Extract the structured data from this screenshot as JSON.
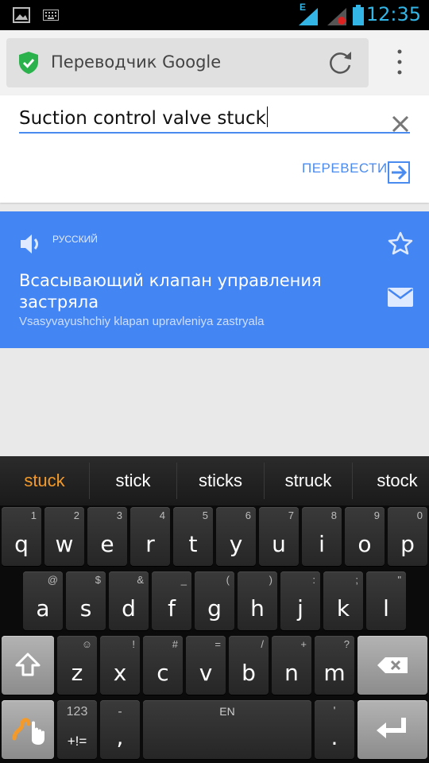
{
  "status_bar": {
    "time": "12:35",
    "network_type": "E"
  },
  "browser": {
    "tab_title": "Переводчик Google"
  },
  "input": {
    "text": "Suction control valve stuck",
    "translate_label": "ПЕРЕВЕСТИ"
  },
  "result": {
    "language": "РУССКИЙ",
    "translation": "Всасывающий клапан управления застряла",
    "transliteration": "Vsasyvayushchiy klapan upravleniya zastryala"
  },
  "keyboard": {
    "suggestions": [
      "stuck",
      "stick",
      "sticks",
      "struck",
      "stock"
    ],
    "row1": [
      {
        "main": "q",
        "alt": "1"
      },
      {
        "main": "w",
        "alt": "2"
      },
      {
        "main": "e",
        "alt": "3"
      },
      {
        "main": "r",
        "alt": "4"
      },
      {
        "main": "t",
        "alt": "5"
      },
      {
        "main": "y",
        "alt": "6"
      },
      {
        "main": "u",
        "alt": "7"
      },
      {
        "main": "i",
        "alt": "8"
      },
      {
        "main": "o",
        "alt": "9"
      },
      {
        "main": "p",
        "alt": "0"
      }
    ],
    "row2": [
      {
        "main": "a",
        "alt": "@"
      },
      {
        "main": "s",
        "alt": "$"
      },
      {
        "main": "d",
        "alt": "&"
      },
      {
        "main": "f",
        "alt": "_"
      },
      {
        "main": "g",
        "alt": "("
      },
      {
        "main": "h",
        "alt": ")"
      },
      {
        "main": "j",
        "alt": ":"
      },
      {
        "main": "k",
        "alt": ";"
      },
      {
        "main": "l",
        "alt": "\""
      }
    ],
    "row3": [
      {
        "main": "z",
        "alt": "☺"
      },
      {
        "main": "x",
        "alt": "!"
      },
      {
        "main": "c",
        "alt": "#"
      },
      {
        "main": "v",
        "alt": "="
      },
      {
        "main": "b",
        "alt": "/"
      },
      {
        "main": "n",
        "alt": "+"
      },
      {
        "main": "m",
        "alt": "?"
      }
    ],
    "symbols_key": {
      "top": "123",
      "bottom": "+!="
    },
    "comma_key": {
      "main": ",",
      "alt": "-"
    },
    "space_label": "EN",
    "period_key": {
      "main": ".",
      "alt": "'"
    }
  },
  "colors": {
    "accent": "#4485f4",
    "suggestion_active": "#f39a2a",
    "shield": "#2bb24c"
  }
}
